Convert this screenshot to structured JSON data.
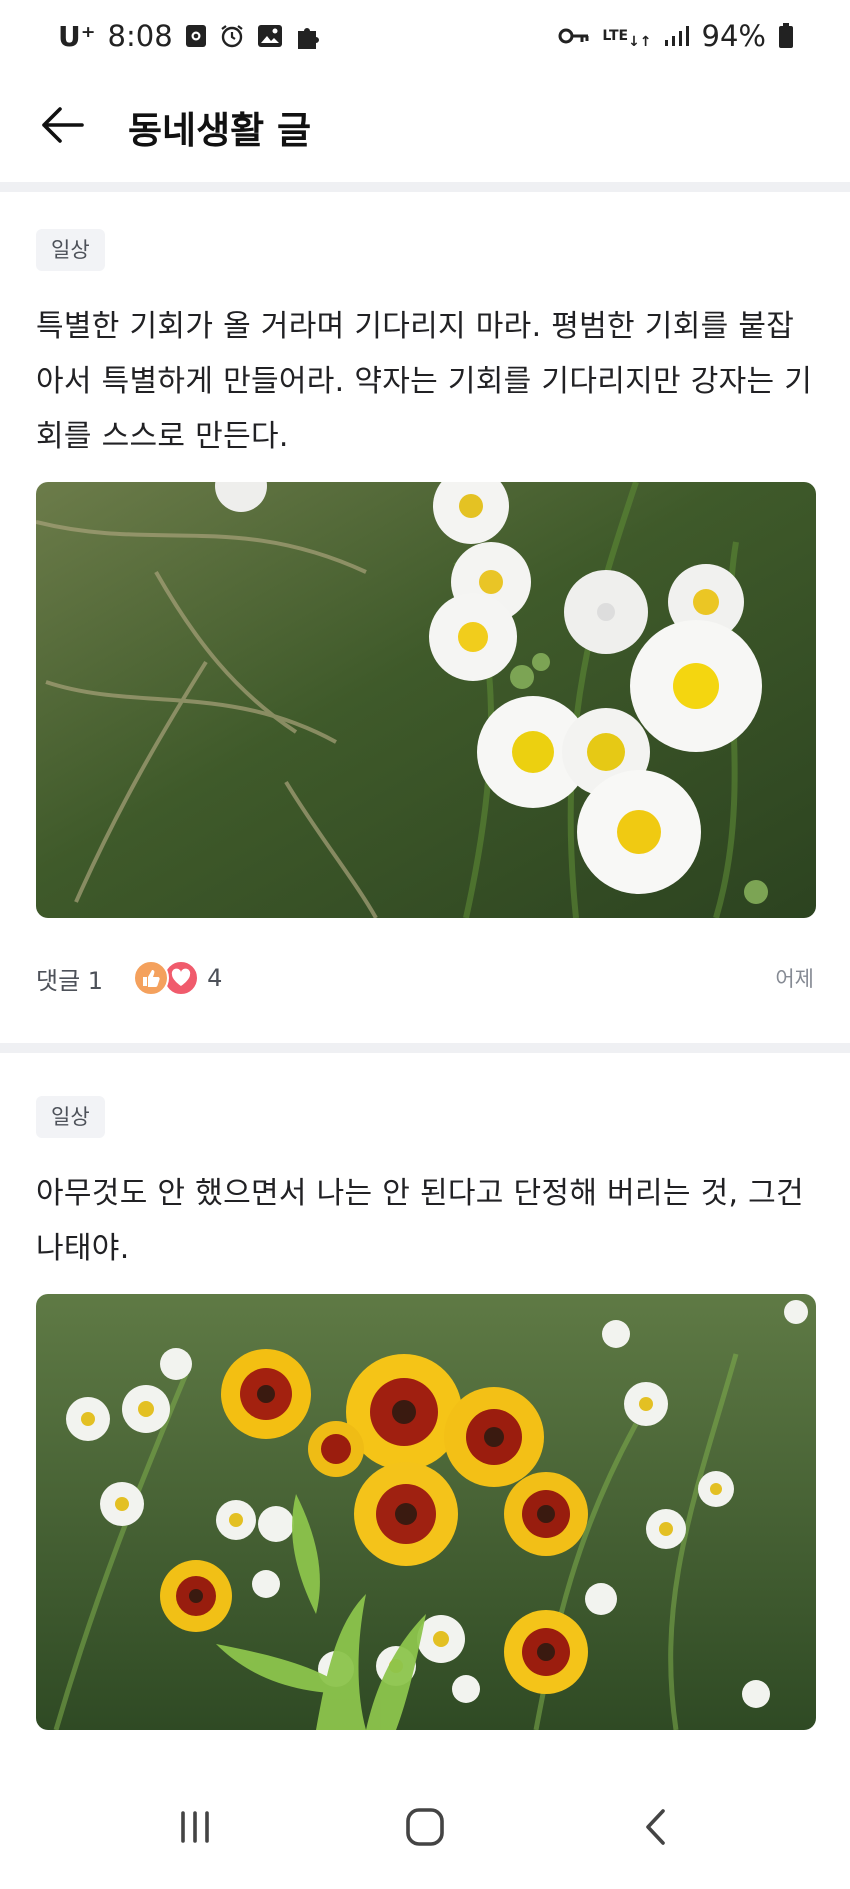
{
  "status_bar": {
    "carrier": "U⁺",
    "time": "8:08",
    "network": "LTE",
    "battery": "94%",
    "icons": [
      "screen-record-icon",
      "alarm-icon",
      "gallery-icon",
      "puzzle-icon",
      "vpn-key-icon",
      "lte-icon",
      "signal-icon",
      "battery-icon"
    ]
  },
  "header": {
    "back_icon": "arrow-left-icon",
    "title": "동네생활 글"
  },
  "posts": [
    {
      "tag": "일상",
      "text": "특별한 기회가 올 거라며 기다리지 마라. 평범한 기회를 붙잡아서 특별하게 만들어라. 약자는 기회를 기다리지만 강자는 기회를 스스로 만든다.",
      "image": "white-daisy-fleabane-photo",
      "comment_label": "댓글 1",
      "reaction_count": "4",
      "time": "어제"
    },
    {
      "tag": "일상",
      "text": "아무것도 안 했으면서 나는 안 된다고 단정해 버리는 것, 그건 나태야.",
      "image": "yellow-red-coreopsis-photo"
    }
  ],
  "nav": {
    "icons": [
      "recent-apps-icon",
      "home-icon",
      "back-icon"
    ]
  },
  "colors": {
    "divider": "#eff0f3",
    "tag_bg": "#f2f3f6",
    "like": "#f4a15d",
    "heart": "#f05b6c"
  }
}
